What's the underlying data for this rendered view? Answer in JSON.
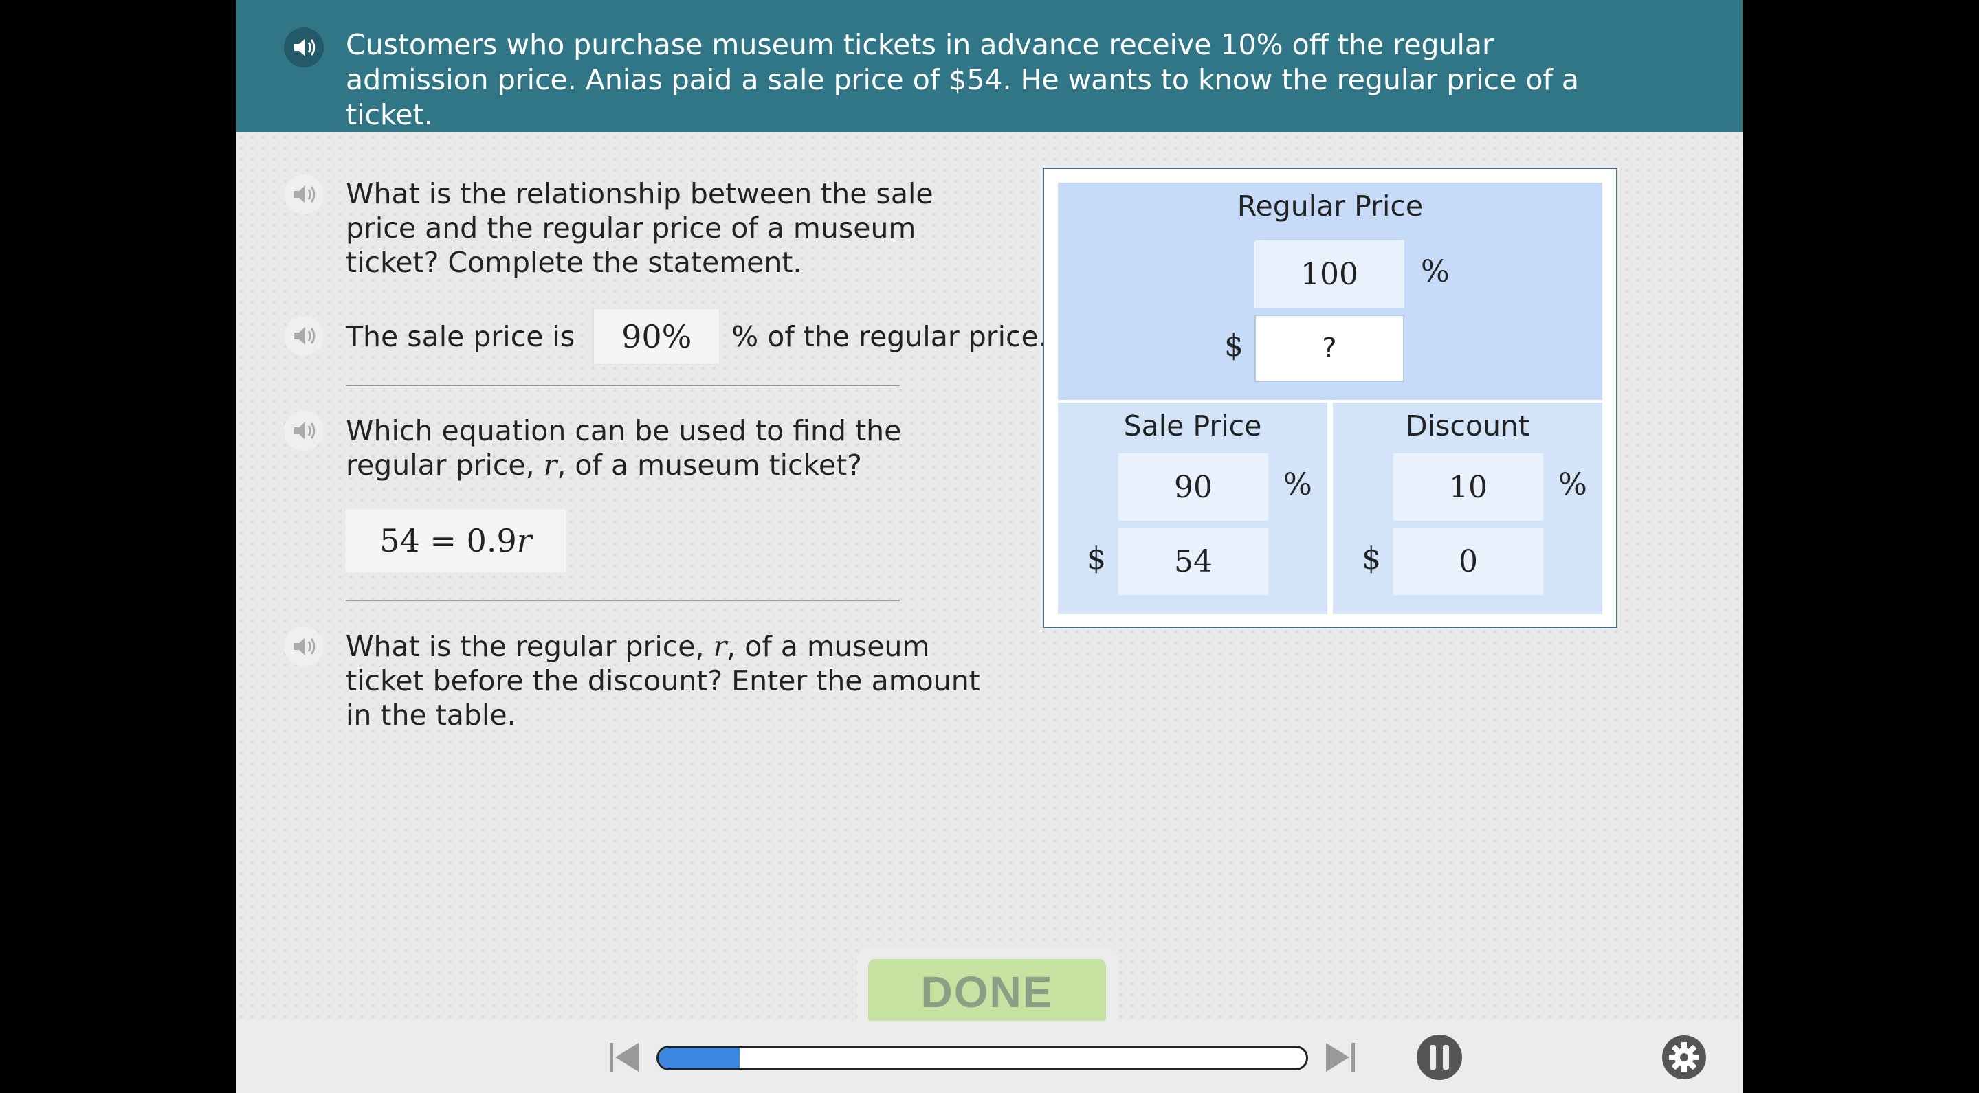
{
  "header": {
    "problem_text": "Customers who purchase museum tickets in advance receive 10% off the regular admission price. Anias paid a sale price of $54. He wants to know the regular price of a ticket."
  },
  "question1": {
    "text": "What is the relationship between the sale price and the regular price of a museum ticket? Complete the statement.",
    "sentence_start": "The sale price is",
    "answer": "90%",
    "sentence_end": "% of the regular price."
  },
  "question2": {
    "text_before_var": "Which equation can be used to find the regular price,",
    "variable": "r",
    "text_after_var": ", of a museum ticket?",
    "equation": {
      "lhs": "54",
      "op": "=",
      "coef": "0.9",
      "var": "r"
    }
  },
  "question3": {
    "text_before_var": "What is the regular price,",
    "variable": "r",
    "text_after_var": ", of a museum ticket before the discount? Enter the amount in the table."
  },
  "tape_diagram": {
    "regular": {
      "title": "Regular Price",
      "percent": "100",
      "percent_symbol": "%",
      "dollar_symbol": "$",
      "dollar": "?"
    },
    "sale": {
      "title": "Sale Price",
      "percent": "90",
      "percent_symbol": "%",
      "dollar_symbol": "$",
      "dollar": "54"
    },
    "discount": {
      "title": "Discount",
      "percent": "10",
      "percent_symbol": "%",
      "dollar_symbol": "$",
      "dollar": "0"
    }
  },
  "done_button": {
    "label": "DONE"
  },
  "player": {
    "progress_fraction": 0.125
  },
  "icons": {
    "speaker": "speaker-icon",
    "prev": "skip-back-icon",
    "next": "skip-forward-icon",
    "pause": "pause-icon",
    "settings": "gear-icon"
  },
  "colors": {
    "header_bg": "#307686",
    "progress_fill": "#3c87e0",
    "done_bg": "#c5e2a0",
    "regular_bg": "#c6dbf7",
    "section_bg": "#d3e3f8"
  }
}
